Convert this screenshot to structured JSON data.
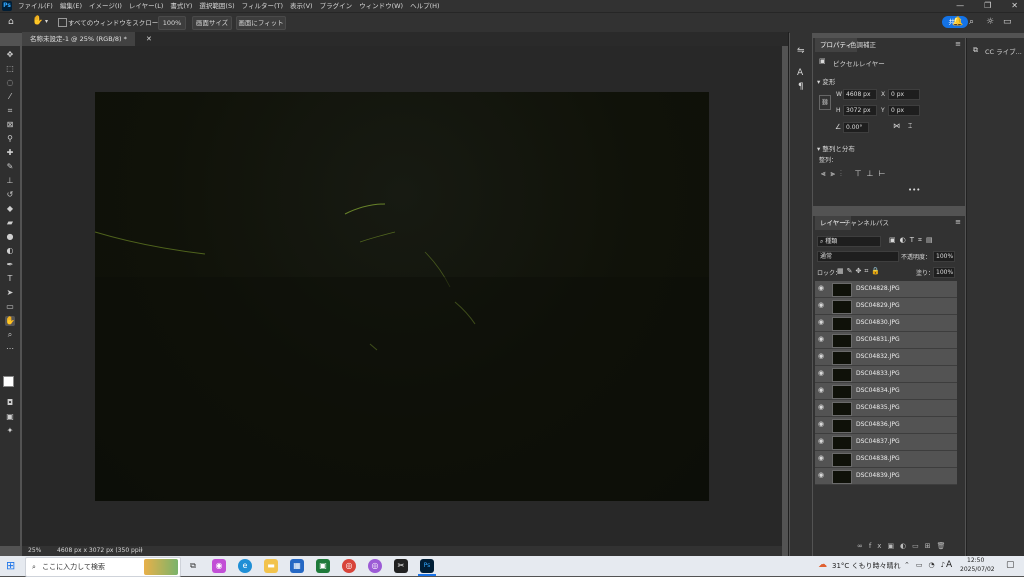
{
  "menubar": {
    "app_icon": "Ps",
    "items": [
      "ファイル(F)",
      "編集(E)",
      "イメージ(I)",
      "レイヤー(L)",
      "書式(Y)",
      "選択範囲(S)",
      "フィルター(T)",
      "表示(V)",
      "プラグイン",
      "ウィンドウ(W)",
      "ヘルプ(H)"
    ],
    "win_minimize": "—",
    "win_maximize": "❐",
    "win_close": "✕"
  },
  "options": {
    "scroll_all_label": "すべてのウィンドウをスクロール",
    "zoom_100": "100%",
    "fit_screen_size": "画面サイズ",
    "fit_screen": "画面にフィット",
    "share": "共有"
  },
  "document": {
    "tab_title": "名称未設定-1 @ 25% (RGB/8) *",
    "zoom": "25%",
    "size_info": "4608 px x 3072 px (350 ppi)"
  },
  "properties": {
    "tab1": "プロパティ",
    "tab2": "色調補正",
    "pixel_layer": "ピクセルレイヤー",
    "transform_title": "変形",
    "w_label": "W",
    "w_value": "4608 px",
    "h_label": "H",
    "h_value": "3072 px",
    "x_label": "X",
    "x_value": "0 px",
    "y_label": "Y",
    "y_value": "0 px",
    "angle_value": "0.00°",
    "align_title": "整列と分布",
    "align_label": "整列：",
    "more": "•••"
  },
  "layers": {
    "tab1": "レイヤー",
    "tab2": "チャンネル",
    "tab3": "パス",
    "kind_filter": "種類",
    "blend_mode": "通常",
    "opacity_label": "不透明度：",
    "opacity_value": "100%",
    "lock_label": "ロック：",
    "fill_label": "塗り：",
    "fill_value": "100%",
    "items": [
      {
        "name": "DSC04828.JPG"
      },
      {
        "name": "DSC04829.JPG"
      },
      {
        "name": "DSC04830.JPG"
      },
      {
        "name": "DSC04831.JPG"
      },
      {
        "name": "DSC04832.JPG"
      },
      {
        "name": "DSC04833.JPG"
      },
      {
        "name": "DSC04834.JPG"
      },
      {
        "name": "DSC04835.JPG"
      },
      {
        "name": "DSC04836.JPG"
      },
      {
        "name": "DSC04837.JPG"
      },
      {
        "name": "DSC04838.JPG"
      },
      {
        "name": "DSC04839.JPG"
      }
    ]
  },
  "right_dock": {
    "cc_libraries": "CC ライブ..."
  },
  "taskbar": {
    "search_placeholder": "ここに入力して検索",
    "weather": "31°C くもり時々晴れ",
    "time": "12:50",
    "date": "2025/07/02",
    "ime": "A"
  },
  "colors": {
    "accent": "#1473e6",
    "panel": "#323232",
    "canvas_bg": "#282828",
    "layer_row": "#535353"
  }
}
